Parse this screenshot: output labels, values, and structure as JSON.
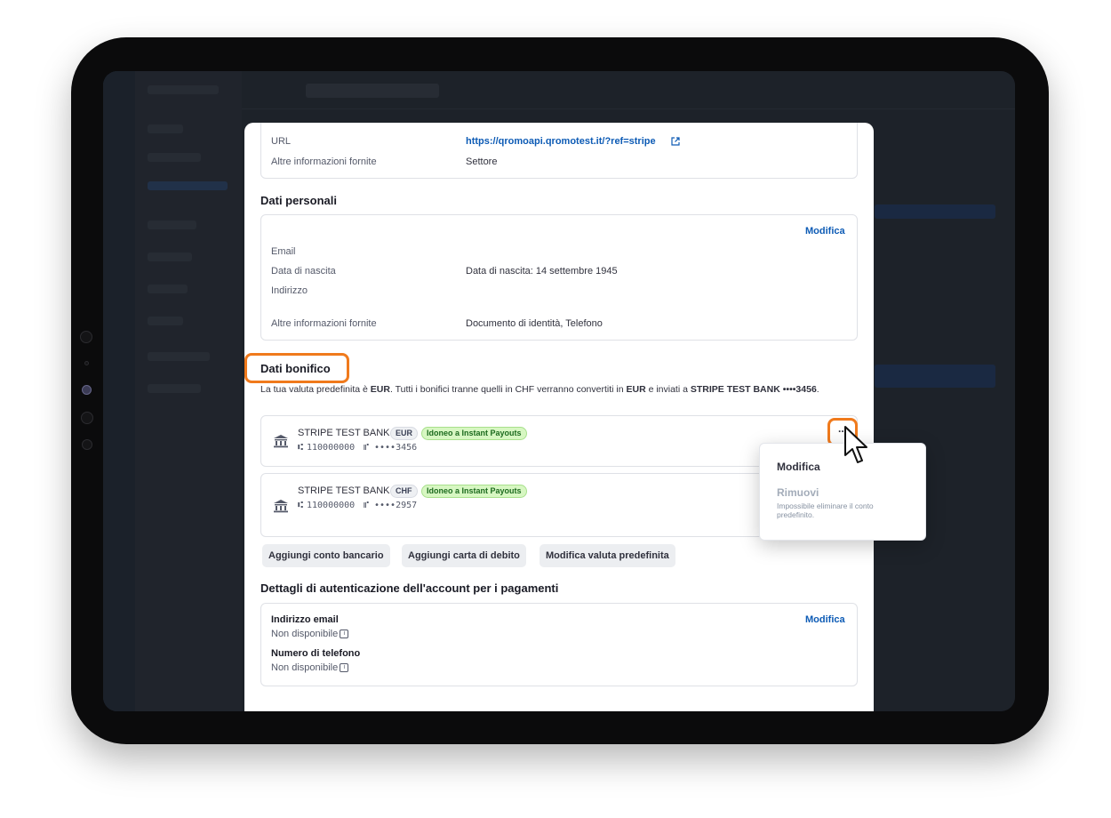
{
  "business_info": {
    "url_label": "URL",
    "url_value": "https://qromoapi.qromotest.it/?ref=stripe",
    "other_label": "Altre informazioni fornite",
    "other_value": "Settore"
  },
  "personal": {
    "title": "Dati personali",
    "edit_label": "Modifica",
    "rows": [
      {
        "label": "Email",
        "value": ""
      },
      {
        "label": "Data di nascita",
        "value": "Data di nascita: 14 settembre 1945"
      },
      {
        "label": "Indirizzo",
        "value": ""
      },
      {
        "label": "Altre informazioni fornite",
        "value": "Documento di identità, Telefono"
      }
    ]
  },
  "payout": {
    "title": "Dati bonifico",
    "desc_1": "La tua valuta predefinita è ",
    "desc_currency": "EUR",
    "desc_2": ". Tutti i bonifici tranne quelli in CHF verranno convertiti in ",
    "desc_currency_2": "EUR",
    "desc_3": " e inviati a ",
    "desc_bank": "STRIPE TEST BANK",
    "desc_last4": "••••3456",
    "desc_end": ".",
    "accounts": [
      {
        "bank": "STRIPE TEST BANK",
        "currency": "EUR",
        "badge": "Idoneo a Instant Payouts",
        "routing": "110000000",
        "last4": "••••3456"
      },
      {
        "bank": "STRIPE TEST BANK",
        "currency": "CHF",
        "badge": "Idoneo a Instant Payouts",
        "routing": "110000000",
        "last4": "••••2957"
      }
    ],
    "more_label": "...",
    "buttons": [
      "Aggiungi conto bancario",
      "Aggiungi carta di debito",
      "Modifica valuta predefinita"
    ]
  },
  "menu": {
    "edit": "Modifica",
    "remove": "Rimuovi",
    "remove_note": "Impossibile eliminare il conto predefinito."
  },
  "auth": {
    "title": "Dettagli di autenticazione dell'account per i pagamenti",
    "edit_label": "Modifica",
    "email_label": "Indirizzo email",
    "email_value": "Non disponibile",
    "phone_label": "Numero di telefono",
    "phone_value": "Non disponibile"
  },
  "colors": {
    "highlight": "#f07a1c",
    "link": "#0d5bb5",
    "badge_green": "#d7f7c2"
  },
  "icons": [
    "bank-icon",
    "external-link-icon",
    "info-icon",
    "cursor-pointer-icon",
    "more-icon"
  ]
}
